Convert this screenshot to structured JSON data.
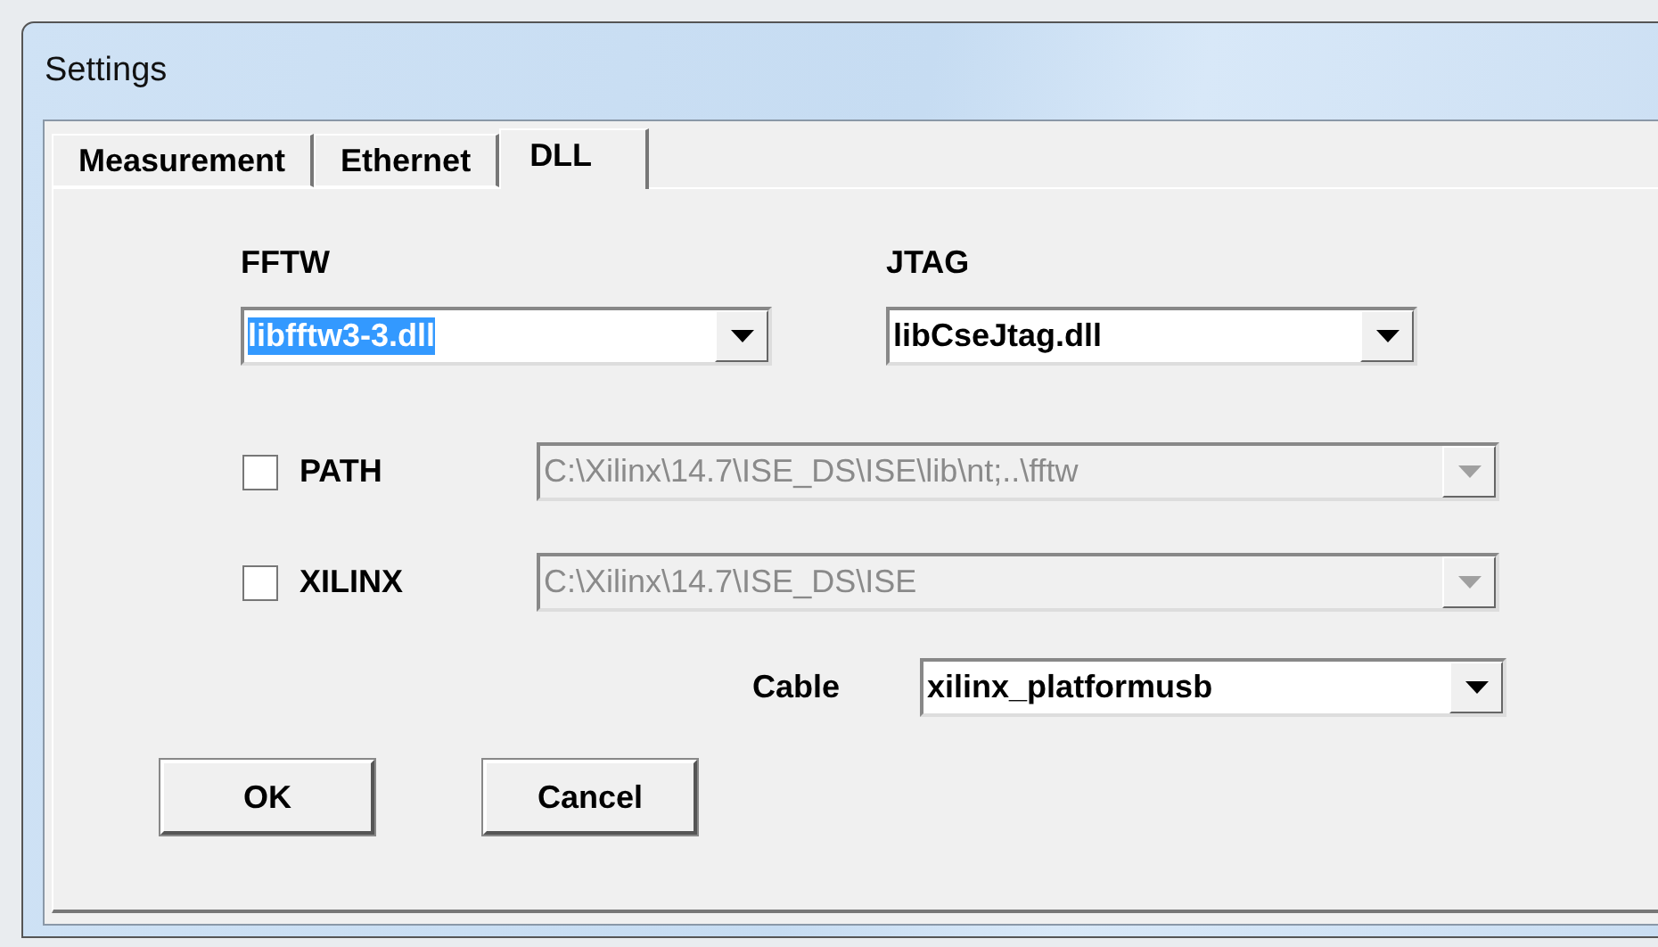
{
  "window": {
    "title": "Settings"
  },
  "tabs": [
    {
      "label": "Measurement",
      "selected": false
    },
    {
      "label": "Ethernet",
      "selected": false
    },
    {
      "label": "DLL",
      "selected": true
    }
  ],
  "libraries": [
    {
      "label": "FFTW",
      "value": "libfftw3-3.dll",
      "highlighted": true
    },
    {
      "label": "JTAG",
      "value": "libCseJtag.dll",
      "highlighted": false
    }
  ],
  "paths": [
    {
      "label": "PATH",
      "checked": false,
      "value": "C:\\Xilinx\\14.7\\ISE_DS\\ISE\\lib\\nt;..\\fftw",
      "disabled": true
    },
    {
      "label": "XILINX",
      "checked": false,
      "value": "C:\\Xilinx\\14.7\\ISE_DS\\ISE",
      "disabled": true
    }
  ],
  "cable": {
    "label": "Cable",
    "value": "xilinx_platformusb"
  },
  "buttons": [
    "OK",
    "Cancel"
  ]
}
